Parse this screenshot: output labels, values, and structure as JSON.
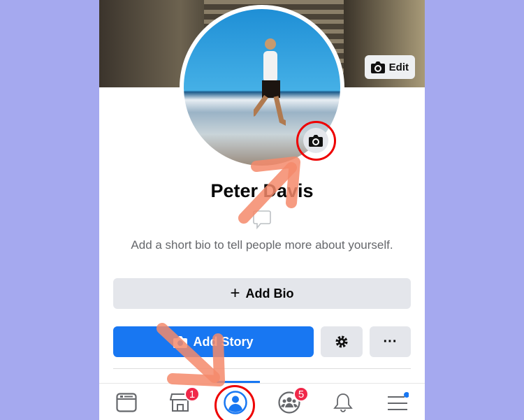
{
  "cover": {
    "edit_label": "Edit",
    "edit_icon": "camera-icon"
  },
  "profile": {
    "name": "Peter Davis",
    "bio_prompt": "Add a short bio to tell people more about yourself.",
    "avatar_camera_icon": "camera-icon"
  },
  "actions": {
    "add_bio": "Add Bio",
    "add_story": "Add Story",
    "settings_icon": "gear-icon",
    "more_label": "···"
  },
  "nav": {
    "items": [
      {
        "icon": "news-feed-icon"
      },
      {
        "icon": "marketplace-icon",
        "badge": "1"
      },
      {
        "icon": "profile-icon",
        "active": true
      },
      {
        "icon": "groups-icon",
        "badge": "5"
      },
      {
        "icon": "bell-icon"
      },
      {
        "icon": "menu-icon",
        "dot": true
      }
    ]
  },
  "colors": {
    "accent": "#1877f2",
    "highlight": "#e00000",
    "annotation_arrow": "#f4896b",
    "badge": "#f02849",
    "background": "#a5a9ef"
  }
}
